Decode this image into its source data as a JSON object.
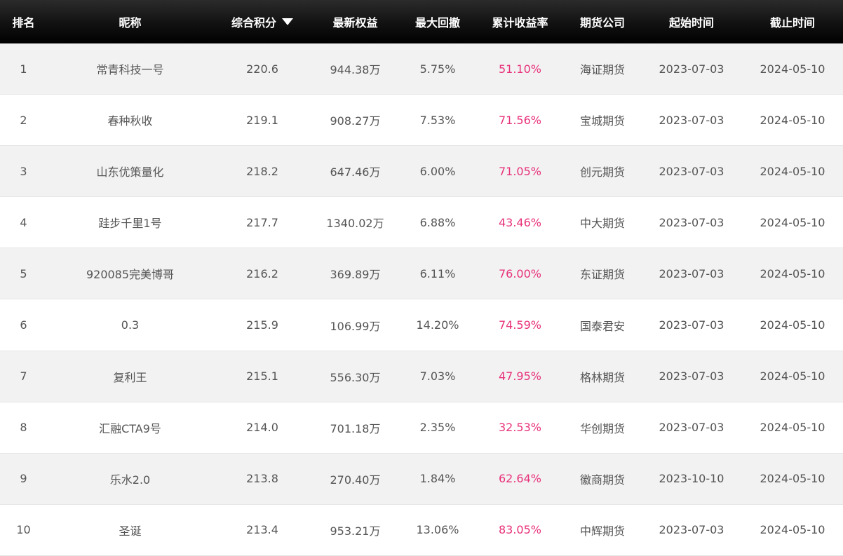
{
  "header": {
    "rank": "排名",
    "nickname": "昵称",
    "score": "综合积分",
    "equity": "最新权益",
    "max_drawdown": "最大回撤",
    "cum_return": "累计收益率",
    "broker": "期货公司",
    "start": "起始时间",
    "end": "截止时间"
  },
  "sort_icon": "caret-down-icon",
  "colors": {
    "header_bg": "#111111",
    "return_text": "#e8317a",
    "stripe": "#f2f2f2"
  },
  "rows": [
    {
      "rank": "1",
      "nickname": "常青科技一号",
      "score": "220.6",
      "equity": "944.38万",
      "max_drawdown": "5.75%",
      "cum_return": "51.10%",
      "broker": "海证期货",
      "start": "2023-07-03",
      "end": "2024-05-10"
    },
    {
      "rank": "2",
      "nickname": "春种秋收",
      "score": "219.1",
      "equity": "908.27万",
      "max_drawdown": "7.53%",
      "cum_return": "71.56%",
      "broker": "宝城期货",
      "start": "2023-07-03",
      "end": "2024-05-10"
    },
    {
      "rank": "3",
      "nickname": "山东优策量化",
      "score": "218.2",
      "equity": "647.46万",
      "max_drawdown": "6.00%",
      "cum_return": "71.05%",
      "broker": "创元期货",
      "start": "2023-07-03",
      "end": "2024-05-10"
    },
    {
      "rank": "4",
      "nickname": "跬步千里1号",
      "score": "217.7",
      "equity": "1340.02万",
      "max_drawdown": "6.88%",
      "cum_return": "43.46%",
      "broker": "中大期货",
      "start": "2023-07-03",
      "end": "2024-05-10"
    },
    {
      "rank": "5",
      "nickname": "920085完美博哥",
      "score": "216.2",
      "equity": "369.89万",
      "max_drawdown": "6.11%",
      "cum_return": "76.00%",
      "broker": "东证期货",
      "start": "2023-07-03",
      "end": "2024-05-10"
    },
    {
      "rank": "6",
      "nickname": "0.3",
      "score": "215.9",
      "equity": "106.99万",
      "max_drawdown": "14.20%",
      "cum_return": "74.59%",
      "broker": "国泰君安",
      "start": "2023-07-03",
      "end": "2024-05-10"
    },
    {
      "rank": "7",
      "nickname": "复利王",
      "score": "215.1",
      "equity": "556.30万",
      "max_drawdown": "7.03%",
      "cum_return": "47.95%",
      "broker": "格林期货",
      "start": "2023-07-03",
      "end": "2024-05-10"
    },
    {
      "rank": "8",
      "nickname": "汇融CTA9号",
      "score": "214.0",
      "equity": "701.18万",
      "max_drawdown": "2.35%",
      "cum_return": "32.53%",
      "broker": "华创期货",
      "start": "2023-07-03",
      "end": "2024-05-10"
    },
    {
      "rank": "9",
      "nickname": "乐水2.0",
      "score": "213.8",
      "equity": "270.40万",
      "max_drawdown": "1.84%",
      "cum_return": "62.64%",
      "broker": "徽商期货",
      "start": "2023-10-10",
      "end": "2024-05-10"
    },
    {
      "rank": "10",
      "nickname": "圣诞",
      "score": "213.4",
      "equity": "953.21万",
      "max_drawdown": "13.06%",
      "cum_return": "83.05%",
      "broker": "中辉期货",
      "start": "2023-07-03",
      "end": "2024-05-10"
    }
  ]
}
